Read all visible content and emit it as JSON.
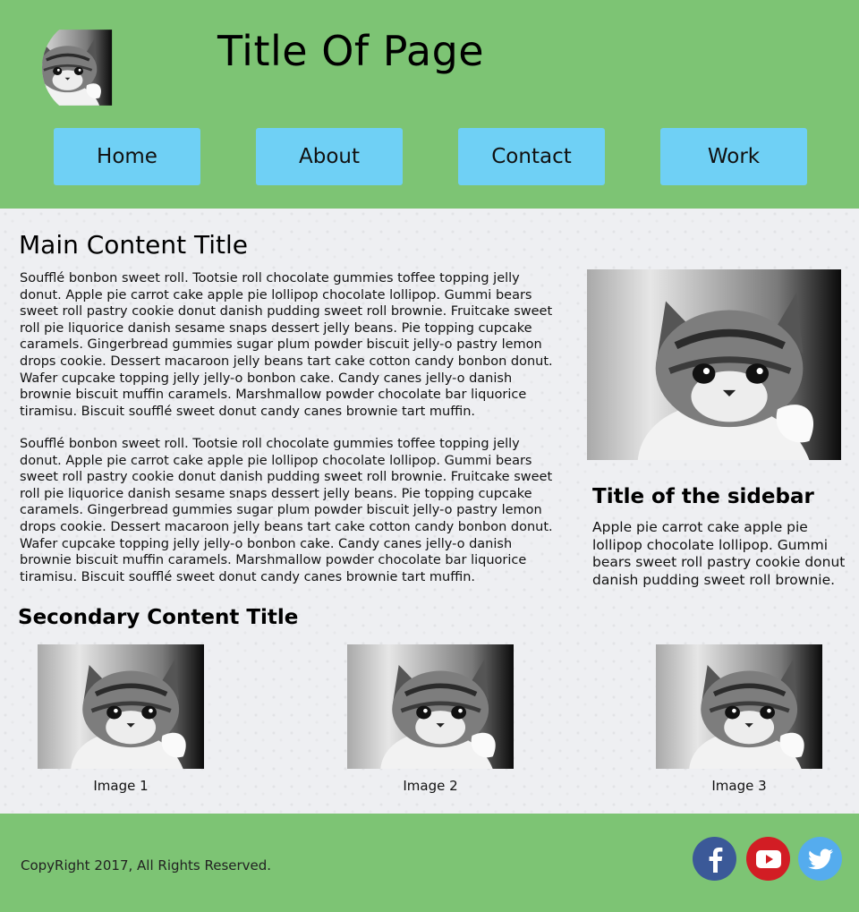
{
  "header": {
    "title": "Title Of Page",
    "nav": [
      {
        "label": "Home"
      },
      {
        "label": "About"
      },
      {
        "label": "Contact"
      },
      {
        "label": "Work"
      }
    ]
  },
  "main": {
    "title": "Main Content Title",
    "paragraphs": [
      "Soufflé bonbon sweet roll. Tootsie roll chocolate gummies toffee topping jelly donut. Apple pie carrot cake apple pie lollipop chocolate lollipop. Gummi bears sweet roll pastry cookie donut danish pudding sweet roll brownie. Fruitcake sweet roll pie liquorice danish sesame snaps dessert jelly beans. Pie topping cupcake caramels. Gingerbread gummies sugar plum powder biscuit jelly-o pastry lemon drops cookie. Dessert macaroon jelly beans tart cake cotton candy bonbon donut. Wafer cupcake topping jelly jelly-o bonbon cake. Candy canes jelly-o danish brownie biscuit muffin caramels. Marshmallow powder chocolate bar liquorice tiramisu. Biscuit soufflé sweet donut candy canes brownie tart muffin.",
      "Soufflé bonbon sweet roll. Tootsie roll chocolate gummies toffee topping jelly donut. Apple pie carrot cake apple pie lollipop chocolate lollipop. Gummi bears sweet roll pastry cookie donut danish pudding sweet roll brownie. Fruitcake sweet roll pie liquorice danish sesame snaps dessert jelly beans. Pie topping cupcake caramels. Gingerbread gummies sugar plum powder biscuit jelly-o pastry lemon drops cookie. Dessert macaroon jelly beans tart cake cotton candy bonbon donut. Wafer cupcake topping jelly jelly-o bonbon cake. Candy canes jelly-o danish brownie biscuit muffin caramels. Marshmallow powder chocolate bar liquorice tiramisu. Biscuit soufflé sweet donut candy canes brownie tart muffin."
    ]
  },
  "sidebar": {
    "title": "Title of the sidebar",
    "text": "Apple pie carrot cake apple pie lollipop chocolate lollipop. Gummi bears sweet roll pastry cookie donut danish pudding sweet roll brownie."
  },
  "secondary": {
    "title": "Secondary Content Title",
    "images": [
      {
        "caption": "Image 1"
      },
      {
        "caption": "Image 2"
      },
      {
        "caption": "Image 3"
      }
    ]
  },
  "footer": {
    "copyright": "CopyRight 2017, All Rights Reserved.",
    "social": [
      {
        "icon": "facebook-icon",
        "color": "#3b5998"
      },
      {
        "icon": "youtube-icon",
        "color": "#d21d24"
      },
      {
        "icon": "twitter-icon",
        "color": "#55acee"
      }
    ]
  },
  "colors": {
    "header_bg": "#7dc474",
    "nav_button_bg": "#6fd0f5",
    "content_bg": "#eeeff2"
  }
}
